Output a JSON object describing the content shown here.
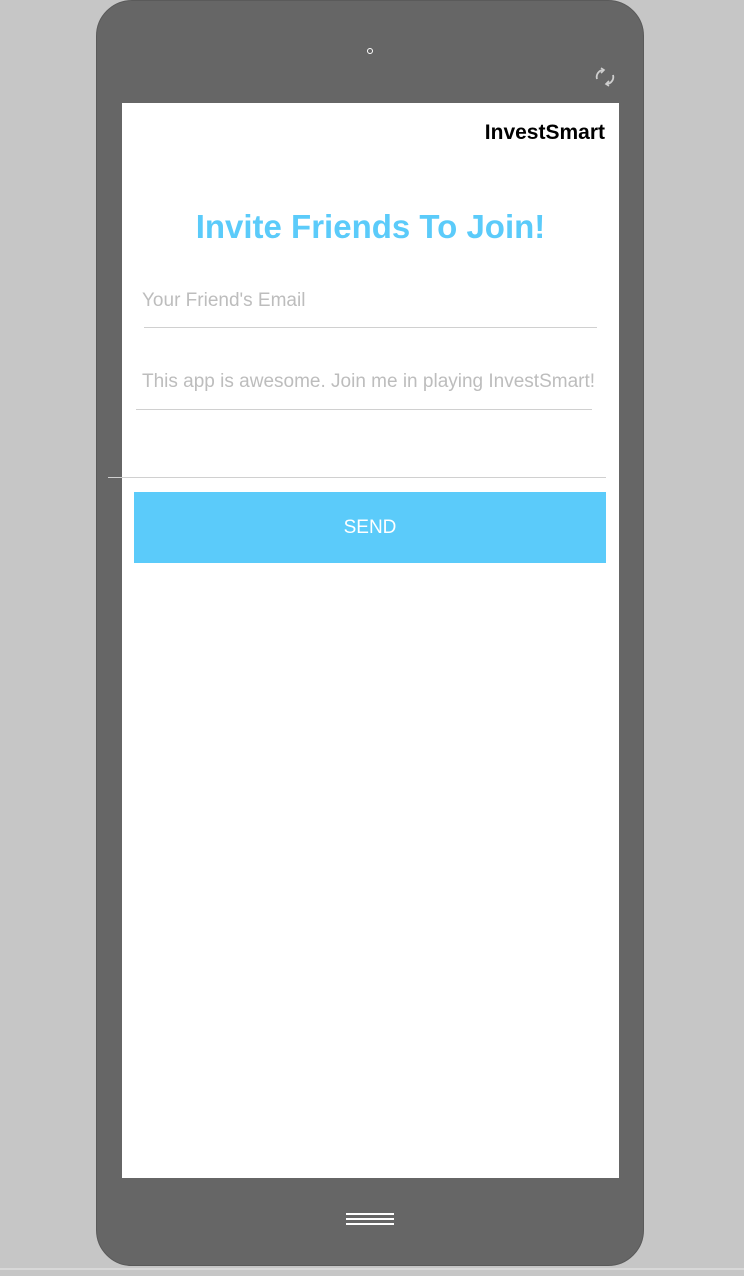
{
  "app": {
    "title": "InvestSmart"
  },
  "invite": {
    "heading": "Invite Friends To Join!",
    "email_placeholder": "Your Friend's Email",
    "email_value": "",
    "message_placeholder": "This app is awesome. Join me in playing InvestSmart!",
    "message_value": "",
    "send_label": "SEND"
  },
  "device": {
    "camera_icon": "camera-dot-icon",
    "rotate_icon": "rotate-icon",
    "home_icon": "home-menu-icon"
  },
  "colors": {
    "accent": "#5bcbfa",
    "device_frame": "#666666",
    "background": "#c6c6c6",
    "screen": "#ffffff"
  }
}
